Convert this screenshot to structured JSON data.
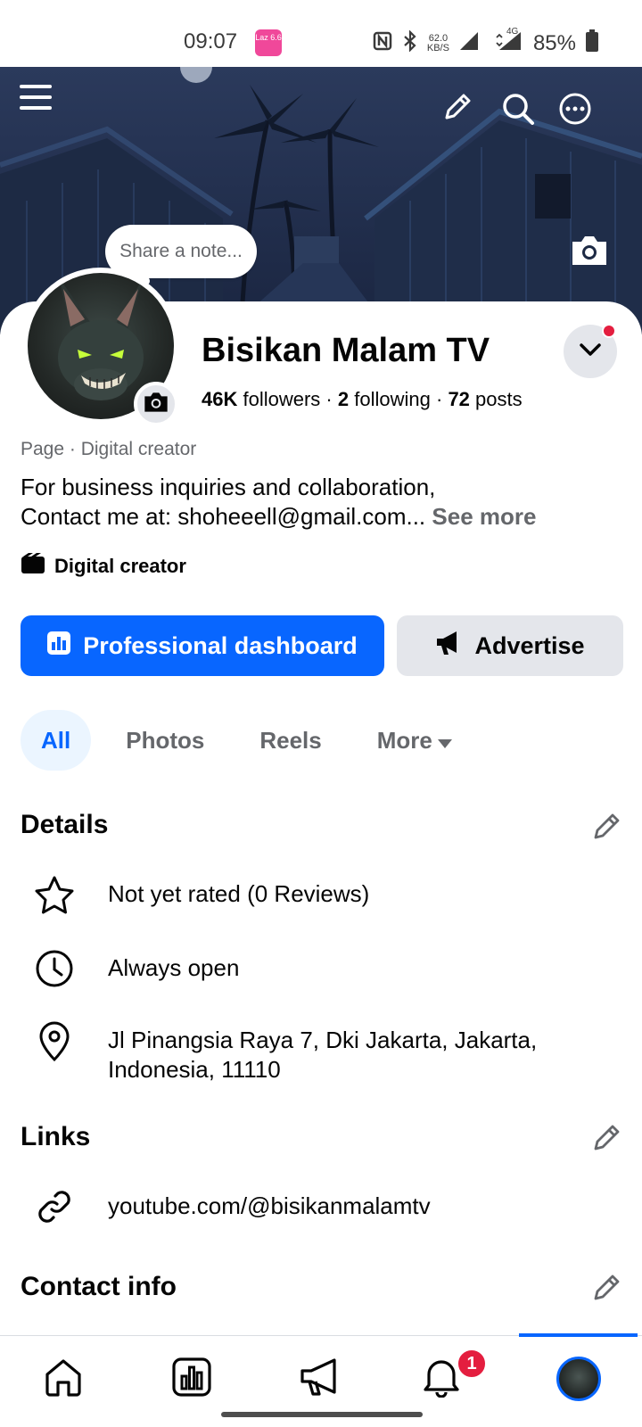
{
  "status_bar": {
    "time": "09:07",
    "app_badge": "Laz 6.6",
    "speed_value": "62.0",
    "speed_unit": "KB/S",
    "network": "4G",
    "battery": "85%"
  },
  "cover": {
    "note_placeholder": "Share a note...",
    "icons": [
      "menu-icon",
      "pencil-icon",
      "search-icon",
      "more-icon",
      "camera-icon"
    ]
  },
  "profile": {
    "name": "Bisikan Malam TV",
    "followers_count": "46K",
    "followers_label": "followers",
    "following_count": "2",
    "following_label": "following",
    "posts_count": "72",
    "posts_label": "posts",
    "category": "Page · Digital creator",
    "bio_line1": "For business inquiries and collaboration,",
    "bio_line2": "Contact me at: shoheeell@gmail.com...",
    "see_more": "See more",
    "creator_tag": "Digital creator"
  },
  "actions": {
    "primary": "Professional dashboard",
    "secondary": "Advertise"
  },
  "tabs": [
    {
      "label": "All",
      "active": true
    },
    {
      "label": "Photos",
      "active": false
    },
    {
      "label": "Reels",
      "active": false
    },
    {
      "label": "More",
      "active": false
    }
  ],
  "details": {
    "title": "Details",
    "rating": "Not yet rated (0 Reviews)",
    "hours": "Always open",
    "address_line1": "Jl Pinangsia Raya 7, Dki Jakarta, Jakarta,",
    "address_line2": "Indonesia, 11110"
  },
  "links": {
    "title": "Links",
    "youtube": "youtube.com/@bisikanmalamtv"
  },
  "contact": {
    "title": "Contact info"
  },
  "bottom_nav": {
    "items": [
      "home-icon",
      "dashboard-icon",
      "megaphone-icon",
      "bell-icon",
      "profile-avatar"
    ],
    "notification_count": "1"
  },
  "colors": {
    "accent": "#0866ff",
    "secondary_bg": "#e4e6eb",
    "muted_text": "#65676b",
    "badge_red": "#e41e3f"
  }
}
